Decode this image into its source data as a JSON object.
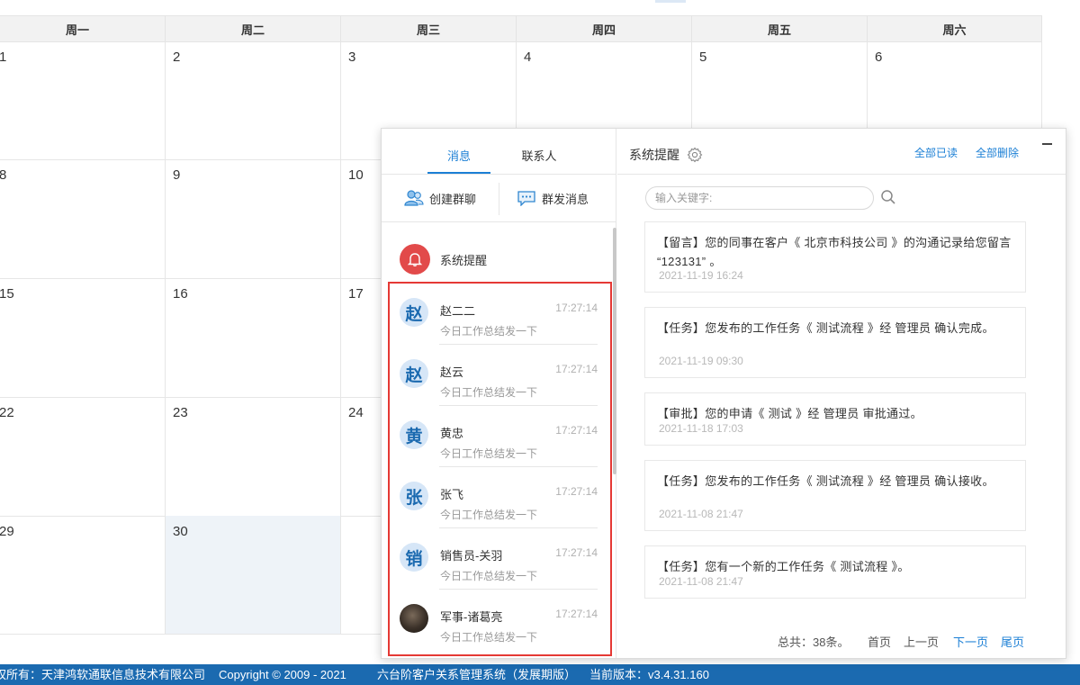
{
  "calendar": {
    "weekdays": [
      "周一",
      "周二",
      "周三",
      "周四",
      "周五",
      "周六"
    ],
    "rows": [
      [
        "1",
        "2",
        "3",
        "4",
        "5",
        "6"
      ],
      [
        "8",
        "9",
        "10",
        "",
        "",
        ""
      ],
      [
        "15",
        "16",
        "17",
        "",
        "",
        ""
      ],
      [
        "22",
        "23",
        "24",
        "",
        "",
        ""
      ],
      [
        "29",
        "30",
        "",
        "",
        "",
        ""
      ]
    ]
  },
  "footer": {
    "copyright_owner": "权所有：天津鸿软通联信息技术有限公司",
    "copyright": "Copyright © 2009 - 2021",
    "system_name": "六台阶客户关系管理系统（发展期版）",
    "version": "当前版本：v3.4.31.160"
  },
  "panel": {
    "tabs": [
      "消息",
      "联系人"
    ],
    "actions": {
      "create_group": "创建群聊",
      "broadcast": "群发消息"
    },
    "system_item": "系统提醒",
    "conversations": [
      {
        "avatar": "赵",
        "name": "赵二二",
        "time": "17:27:14",
        "preview": "今日工作总结发一下"
      },
      {
        "avatar": "赵",
        "name": "赵云",
        "time": "17:27:14",
        "preview": "今日工作总结发一下"
      },
      {
        "avatar": "黄",
        "name": "黄忠",
        "time": "17:27:14",
        "preview": "今日工作总结发一下"
      },
      {
        "avatar": "张",
        "name": "张飞",
        "time": "17:27:14",
        "preview": "今日工作总结发一下"
      },
      {
        "avatar": "销",
        "name": "销售员-关羽",
        "time": "17:27:14",
        "preview": "今日工作总结发一下"
      },
      {
        "avatar": "",
        "name": "军事-诸葛亮",
        "time": "17:27:14",
        "preview": "今日工作总结发一下"
      }
    ],
    "right": {
      "title": "系统提醒",
      "read_all": "全部已读",
      "delete_all": "全部删除",
      "search_placeholder": "输入关键字:",
      "messages": [
        {
          "text": "【留言】您的同事在客户《 北京市科技公司 》的沟通记录给您留言 “123131” 。",
          "date": "2021-11-19 16:24"
        },
        {
          "text": "【任务】您发布的工作任务《 测试流程 》经 管理员 确认完成。",
          "date": "2021-11-19 09:30"
        },
        {
          "text": "【审批】您的申请《 测试 》经 管理员 审批通过。",
          "date": "2021-11-18 17:03"
        },
        {
          "text": "【任务】您发布的工作任务《 测试流程 》经 管理员 确认接收。",
          "date": "2021-11-08 21:47"
        },
        {
          "text": "【任务】您有一个新的工作任务《 测试流程 》。",
          "date": "2021-11-08 21:47"
        }
      ],
      "pager": {
        "total": "总共：38条。",
        "first": "首页",
        "prev": "上一页",
        "next": "下一页",
        "last": "尾页"
      }
    }
  }
}
